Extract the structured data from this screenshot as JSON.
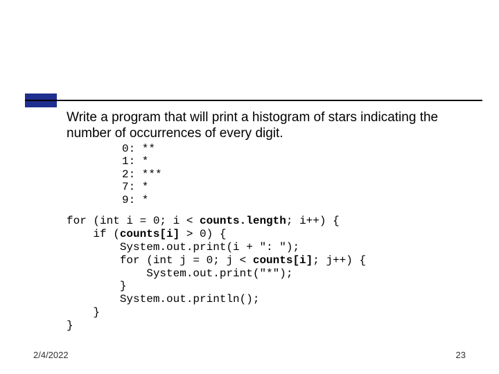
{
  "slide": {
    "prompt": "Write a program that will print a histogram of stars indicating the number of occurrences of every digit.",
    "histogram_lines": {
      "l0": "0: **",
      "l1": "1: *",
      "l2": "2: ***",
      "l3": "7: *",
      "l4": "9: *"
    },
    "code": {
      "l0a": "for (int i = 0; i < ",
      "l0b": "counts.length",
      "l0c": "; i++) {",
      "l1a": "    if (",
      "l1b": "counts[i]",
      "l1c": " > 0) {",
      "l2": "        System.out.print(i + \": \");",
      "l3a": "        for (int j = 0; j < ",
      "l3b": "counts[i]",
      "l3c": "; j++) {",
      "l4": "            System.out.print(\"*\");",
      "l5": "        }",
      "l6": "        System.out.println();",
      "l7": "    }",
      "l8": "}"
    },
    "footer": {
      "date": "2/4/2022",
      "page": "23"
    }
  }
}
